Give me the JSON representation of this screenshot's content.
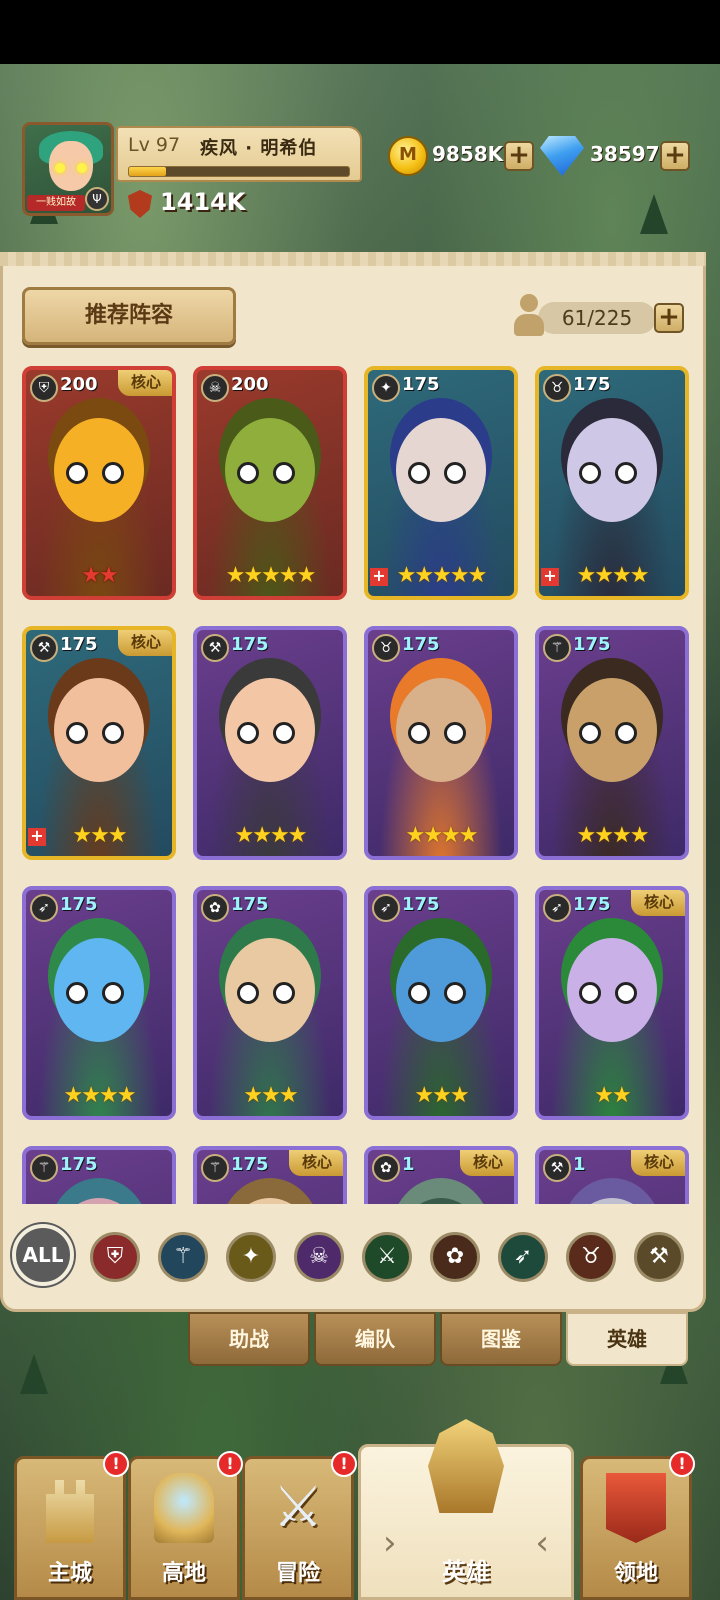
{
  "player": {
    "level_label": "Lv 97",
    "name": "疾风 · 明希伯",
    "exp_fraction": 0.17,
    "power": "1414K",
    "avatar_tag": "一贱如故",
    "avatar_badge": "Ψ"
  },
  "resources": {
    "coins": "9858K",
    "coin_symbol": "M",
    "gems": "38597",
    "plus": "+"
  },
  "panel": {
    "lineup_button": "推荐阵容",
    "capacity": "61/225",
    "plus": "+"
  },
  "heroes": [
    {
      "level": "200",
      "class": "shield",
      "rarity": "red",
      "core": "核心",
      "stars": 2,
      "star_color": "red",
      "upgrade": false
    },
    {
      "level": "200",
      "class": "skull",
      "rarity": "red",
      "core": "",
      "stars": 5,
      "star_color": "gold",
      "upgrade": false
    },
    {
      "level": "175",
      "class": "paladin",
      "rarity": "gold",
      "core": "",
      "stars": 5,
      "star_color": "gold",
      "upgrade": true
    },
    {
      "level": "175",
      "class": "horn",
      "rarity": "gold",
      "core": "",
      "stars": 4,
      "star_color": "gold",
      "upgrade": true
    },
    {
      "level": "175",
      "class": "axe",
      "rarity": "gold",
      "core": "核心",
      "stars": 3,
      "star_color": "gold",
      "upgrade": true
    },
    {
      "level": "175",
      "class": "axe",
      "rarity": "purple",
      "core": "",
      "stars": 4,
      "star_color": "gold",
      "upgrade": false
    },
    {
      "level": "175",
      "class": "horn",
      "rarity": "purple",
      "core": "",
      "stars": 4,
      "star_color": "gold",
      "upgrade": false
    },
    {
      "level": "175",
      "class": "staff",
      "rarity": "purple",
      "core": "",
      "stars": 4,
      "star_color": "gold",
      "upgrade": false
    },
    {
      "level": "175",
      "class": "bow",
      "rarity": "purple",
      "core": "",
      "stars": 4,
      "star_color": "gold",
      "upgrade": false
    },
    {
      "level": "175",
      "class": "paw",
      "rarity": "purple",
      "core": "",
      "stars": 3,
      "star_color": "gold",
      "upgrade": false
    },
    {
      "level": "175",
      "class": "bow",
      "rarity": "purple",
      "core": "",
      "stars": 3,
      "star_color": "gold",
      "upgrade": false
    },
    {
      "level": "175",
      "class": "bow",
      "rarity": "purple",
      "core": "核心",
      "stars": 2,
      "star_color": "gold",
      "upgrade": false
    },
    {
      "level": "175",
      "class": "staff",
      "rarity": "purple",
      "core": "",
      "stars": 0,
      "star_color": "gold",
      "upgrade": false
    },
    {
      "level": "175",
      "class": "staff",
      "rarity": "purple",
      "core": "核心",
      "stars": 0,
      "star_color": "gold",
      "upgrade": false
    },
    {
      "level": "1",
      "class": "paw",
      "rarity": "purple",
      "core": "核心",
      "stars": 0,
      "star_color": "gold",
      "upgrade": false
    },
    {
      "level": "1",
      "class": "axe",
      "rarity": "purple",
      "core": "核心",
      "stars": 0,
      "star_color": "gold",
      "upgrade": false
    }
  ],
  "filters": {
    "all_label": "ALL",
    "icons": [
      "shield-icon",
      "staff-icon",
      "paladin-icon",
      "skull-icon",
      "crossed-swords-icon",
      "paw-icon",
      "bow-icon",
      "horn-icon",
      "axe-icon"
    ]
  },
  "subtabs": [
    {
      "label": "助战",
      "active": false
    },
    {
      "label": "编队",
      "active": false
    },
    {
      "label": "图鉴",
      "active": false
    },
    {
      "label": "英雄",
      "active": true
    }
  ],
  "nav": [
    {
      "label": "主城",
      "alert": "!",
      "active": false
    },
    {
      "label": "高地",
      "alert": "!",
      "active": false
    },
    {
      "label": "冒险",
      "alert": "!",
      "active": false
    },
    {
      "label": "英雄",
      "alert": "",
      "active": true
    },
    {
      "label": "领地",
      "alert": "!",
      "active": false
    }
  ],
  "colors": {
    "panel": "#f1e6cb",
    "red_rarity": "#cf3f36",
    "gold_rarity": "#e7b626",
    "purple_rarity": "#8b6fd4",
    "star_gold": "#ffd21f",
    "alert": "#e62a2a"
  }
}
